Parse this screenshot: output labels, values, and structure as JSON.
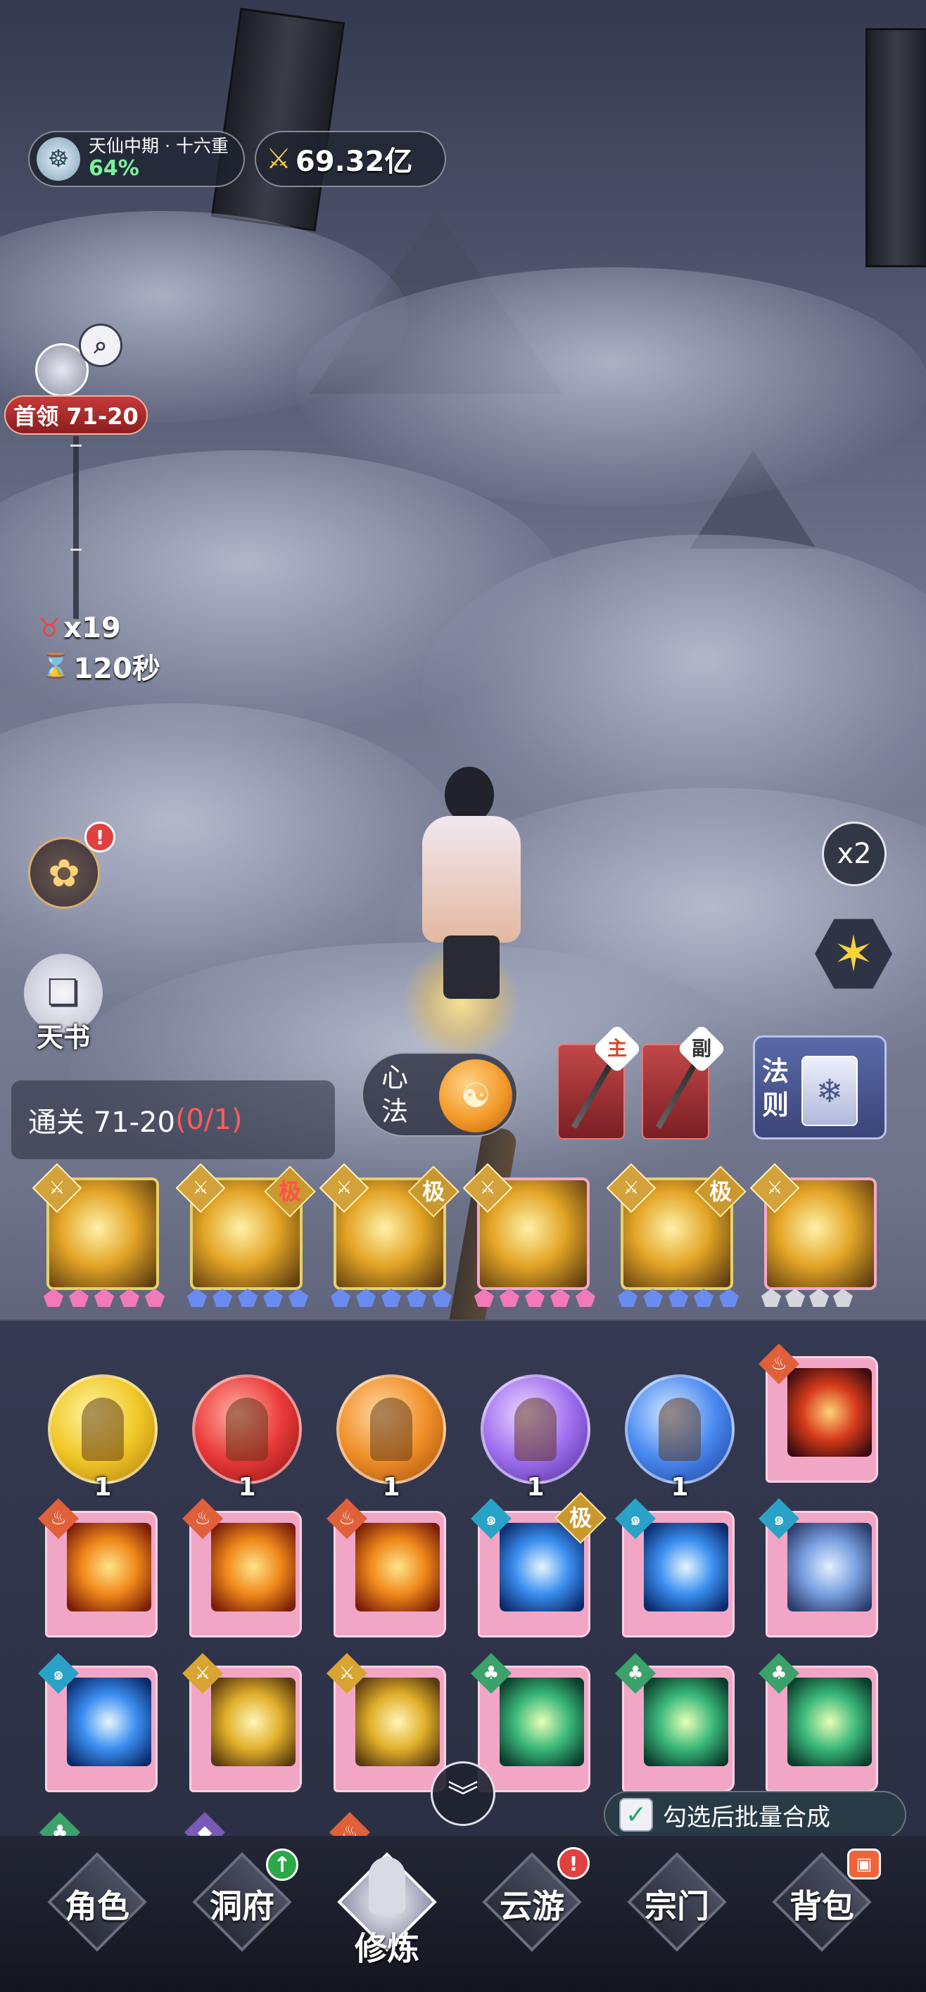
{
  "hud": {
    "realm_name": "天仙中期 · 十六重",
    "realm_progress": "64%",
    "realm_icon": "sect-emblem-icon",
    "power_icon": "crossed-swords-icon",
    "power_value": "69.32亿"
  },
  "stage": {
    "boss_label": "首领 71-20",
    "boss_icon": "mountain-search-icon",
    "enemy_count": "x19",
    "time_remaining": "120秒",
    "clear_text": "通关 71-20",
    "clear_progress": "(0/1)"
  },
  "side_buttons": {
    "gift_badge": "!",
    "book_label": "天书",
    "speed_label": "x2",
    "auto_icon": "gold-hexagram-icon"
  },
  "skill_bar": {
    "xinfa_label": "心法",
    "main_weapon_tag": "主",
    "sub_weapon_tag": "副",
    "law_label": "法则"
  },
  "equipped_skills": [
    {
      "grade": "",
      "gems": [
        "pink",
        "pink",
        "pink",
        "pink",
        "pink"
      ]
    },
    {
      "grade": "极",
      "grade_red": true,
      "gems": [
        "blue",
        "blue",
        "blue",
        "blue",
        "blue"
      ]
    },
    {
      "grade": "极",
      "grade_red": false,
      "gems": [
        "blue",
        "blue",
        "blue",
        "blue",
        "blue"
      ]
    },
    {
      "grade": "",
      "gems": [
        "pink",
        "pink",
        "pink",
        "pink",
        "pink"
      ]
    },
    {
      "grade": "极",
      "grade_red": false,
      "gems": [
        "blue",
        "blue",
        "blue",
        "blue",
        "blue"
      ]
    },
    {
      "grade": "",
      "gems": [
        "grey",
        "grey",
        "grey",
        "grey"
      ]
    }
  ],
  "inventory": {
    "orbs": [
      {
        "color": "yellow",
        "count": "1"
      },
      {
        "color": "red",
        "count": "1"
      },
      {
        "color": "orange",
        "count": "1"
      },
      {
        "color": "purple",
        "count": "1"
      },
      {
        "color": "blue",
        "count": "1"
      }
    ],
    "books_row1": [
      {
        "element": "fire",
        "art": "phoenix",
        "grade": ""
      }
    ],
    "books_row2": [
      {
        "element": "fire",
        "art": "fire",
        "grade": ""
      },
      {
        "element": "fire",
        "art": "fire",
        "grade": ""
      },
      {
        "element": "fire",
        "art": "fire",
        "grade": ""
      },
      {
        "element": "water",
        "art": "ice",
        "grade": "极"
      },
      {
        "element": "water",
        "art": "ice",
        "grade": ""
      },
      {
        "element": "water",
        "art": "mixed",
        "grade": ""
      }
    ],
    "books_row3": [
      {
        "element": "water",
        "art": "ice",
        "grade": ""
      },
      {
        "element": "metal",
        "art": "gold",
        "grade": ""
      },
      {
        "element": "metal",
        "art": "gold",
        "grade": ""
      },
      {
        "element": "wood",
        "art": "green",
        "grade": ""
      },
      {
        "element": "wood",
        "art": "green",
        "grade": ""
      },
      {
        "element": "wood",
        "art": "green",
        "grade": ""
      }
    ],
    "batch_label": "勾选后批量合成",
    "collapse_icon": "double-chevron-down-icon"
  },
  "nav": {
    "items": [
      {
        "label": "角色",
        "badge": ""
      },
      {
        "label": "洞府",
        "badge": "up"
      },
      {
        "label": "修炼",
        "badge": "",
        "active": true
      },
      {
        "label": "云游",
        "badge": "!"
      },
      {
        "label": "宗门",
        "badge": ""
      },
      {
        "label": "背包",
        "badge": "bag"
      }
    ]
  },
  "colors": {
    "accent_gold": "#e8d06a",
    "realm_green": "#7df09c",
    "boss_red": "#c83a3a",
    "count_red": "#ff5c5c"
  }
}
